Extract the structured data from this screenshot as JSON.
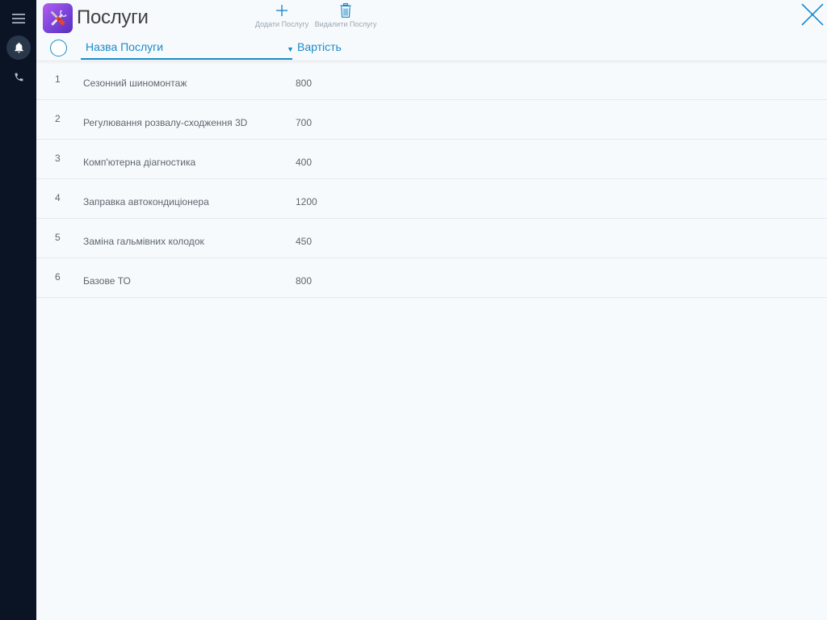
{
  "header": {
    "title": "Послуги",
    "app_icon": "tools-icon",
    "add_label": "Додати Послугу",
    "delete_label": "Видалити Послугу"
  },
  "sidebar": {
    "items": [
      {
        "icon": "menu-icon"
      },
      {
        "icon": "bell-icon"
      },
      {
        "icon": "phone-icon"
      }
    ]
  },
  "table": {
    "columns": {
      "name": "Назва Послуги",
      "price": "Вартість"
    },
    "rows": [
      {
        "num": "1",
        "name": "Сезонний шиномонтаж",
        "price": "800"
      },
      {
        "num": "2",
        "name": "Регулювання розвалу-сходження 3D",
        "price": "700"
      },
      {
        "num": "3",
        "name": "Комп'ютерна діагностика",
        "price": "400"
      },
      {
        "num": "4",
        "name": "Заправка автокондиціонера",
        "price": "1200"
      },
      {
        "num": "5",
        "name": "Заміна гальмівних колодок",
        "price": "450"
      },
      {
        "num": "6",
        "name": "Базове ТО",
        "price": "800"
      }
    ]
  },
  "colors": {
    "accent": "#1a8bc9",
    "sidebar": "#0b1424",
    "background": "#f7fafc"
  }
}
